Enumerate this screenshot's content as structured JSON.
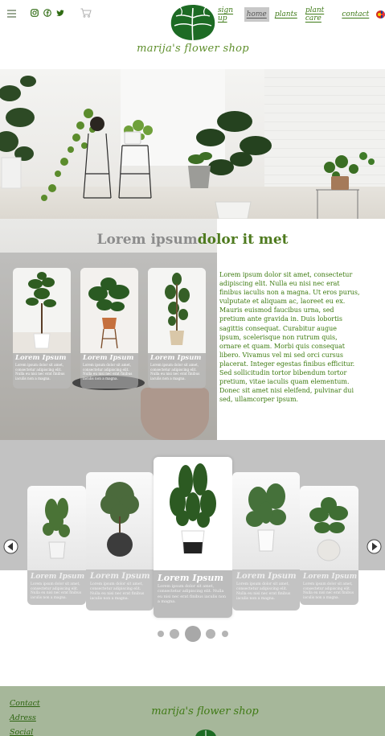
{
  "header": {
    "brand": "marija's flower shop",
    "social_icons": [
      "instagram-icon",
      "facebook-icon",
      "twitter-icon"
    ],
    "nav": [
      {
        "label": "sign up",
        "active": false
      },
      {
        "label": "home",
        "active": true
      },
      {
        "label": "plants",
        "active": false
      },
      {
        "label": "plant care",
        "active": false
      },
      {
        "label": "contact",
        "active": false
      }
    ],
    "language_icons": [
      "macedonian-flag-icon",
      "uk-flag-icon"
    ]
  },
  "about": {
    "title_part1": "Lorem ipsum",
    "title_part2": "dolor it met",
    "text": "Lorem ipsum dolor sit amet, consectetur adipiscing elit. Nulla eu nisi nec erat finibus iaculis non a magna. Ut eros purus, vulputate et aliquam ac, laoreet eu ex. Mauris euismod faucibus urna, sed pretium ante gravida in. Duis lobortis sagittis consequat. Curabitur augue ipsum, scelerisque non rutrum quis, ornare et quam. Morbi quis consequat libero. Vivamus vel mi sed orci cursus placerat. Integer egestas finibus efficitur. Sed sollicitudin tortor bibendum tortor pretium, vitae iaculis quam elementum. Donec sit amet nisi eleifend, pulvinar dui sed, ullamcorper ipsum.",
    "cards": [
      {
        "name": "Lorem Ipsum",
        "desc": "Lorem ipsum dolor sit amet, consectetur adipiscing elit. Nulla eu nisi nec erat finibus iaculis non a magna."
      },
      {
        "name": "Lorem Ipsum",
        "desc": "Lorem ipsum dolor sit amet, consectetur adipiscing elit. Nulla eu nisi nec erat finibus iaculis non a magna."
      },
      {
        "name": "Lorem Ipsum",
        "desc": "Lorem ipsum dolor sit amet, consectetur adipiscing elit. Nulla eu nisi nec erat finibus iaculis non a magna."
      }
    ]
  },
  "carousel": {
    "cards": [
      {
        "name": "Lorem Ipsum",
        "desc": "Lorem ipsum dolor sit amet, consectetur adipiscing elit. Nulla eu nisi nec erat finibus iaculis non a magna."
      },
      {
        "name": "Lorem Ipsum",
        "desc": "Lorem ipsum dolor sit amet, consectetur adipiscing elit. Nulla eu nisi nec erat finibus iaculis non a magna."
      },
      {
        "name": "Lorem Ipsum",
        "desc": "Lorem ipsum dolor sit amet, consectetur adipiscing elit. Nulla eu nisi nec erat finibus iaculis non a magna."
      },
      {
        "name": "Lorem Ipsum",
        "desc": "Lorem ipsum dolor sit amet, consectetur adipiscing elit. Nulla eu nisi nec erat finibus iaculis non a magna."
      },
      {
        "name": "Lorem Ipsum",
        "desc": "Lorem ipsum dolor sit amet, consectetur adipiscing elit. Nulla eu nisi nec erat finibus iaculis non a magna."
      }
    ],
    "dot_count": 5,
    "active_dot": 3
  },
  "footer": {
    "links": [
      "Contact",
      "Adress",
      "Social"
    ],
    "brand": "marija's flower shop"
  },
  "colors": {
    "brand_green": "#2f6b12",
    "carousel_bg": "#c2c2c2",
    "footer_bg": "#a6b79a"
  }
}
